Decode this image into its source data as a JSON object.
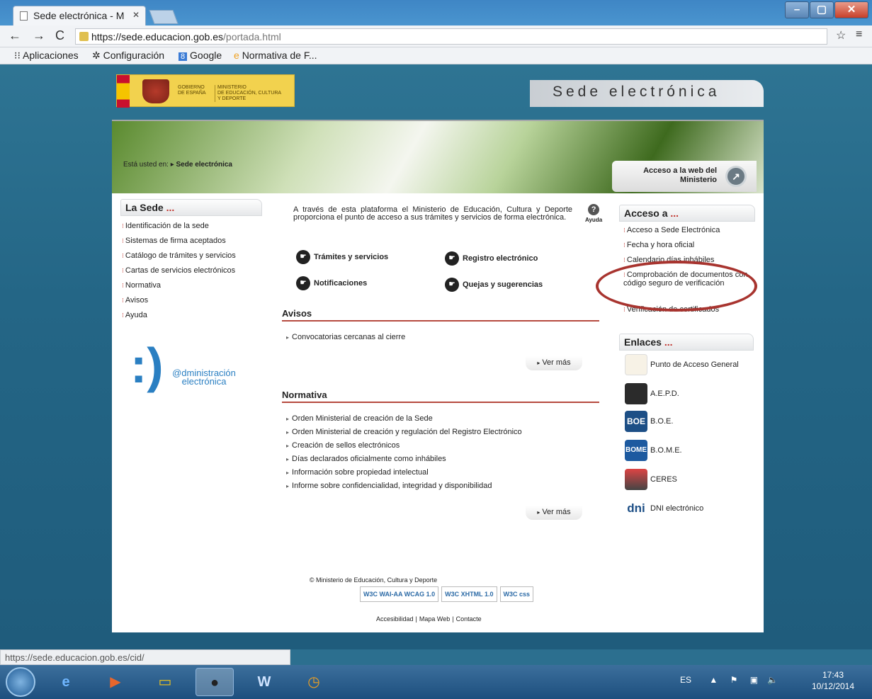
{
  "browser": {
    "tab_title": "Sede electrónica - M",
    "url_host": "https://sede.educacion.gob.es",
    "url_path": "/portada.html",
    "bookmarks": [
      "Aplicaciones",
      "Configuración",
      "Google",
      "Normativa de F..."
    ],
    "status_url": "https://sede.educacion.gob.es/cid/"
  },
  "header": {
    "gov1": "GOBIERNO\nDE ESPAÑA",
    "gov2": "MINISTERIO\nDE EDUCACIÓN, CULTURA\nY DEPORTE",
    "site_title": "Sede electrónica"
  },
  "breadcrumb": {
    "prefix": "Está usted en:",
    "current": "Sede electrónica"
  },
  "access_web": "Acceso a la web del Ministerio",
  "left": {
    "heading": "La Sede",
    "links": [
      "Identificación de la sede",
      "Sistemas de firma aceptados",
      "Catálogo de trámites y servicios",
      "Cartas de servicios electrónicos",
      "Normativa",
      "Avisos",
      "Ayuda"
    ],
    "ae_text": "@dministración electrónica"
  },
  "center": {
    "intro": "A través de esta plataforma el Ministerio de Educación, Cultura y Deporte proporciona el punto de acceso a sus trámites y servicios de forma electrónica.",
    "help": "Ayuda",
    "quick": [
      "Trámites y servicios",
      "Registro electrónico",
      "Notificaciones",
      "Quejas y sugerencias"
    ],
    "avisos_title": "Avisos",
    "avisos": [
      "Convocatorias cercanas al cierre"
    ],
    "normativa_title": "Normativa",
    "normativa": [
      "Orden Ministerial de creación de la Sede",
      "Orden Ministerial de creación y regulación del Registro Electrónico",
      "Creación de sellos electrónicos",
      "Días declarados oficialmente como inhábiles",
      "Información sobre propiedad intelectual",
      "Informe sobre confidencialidad, integridad y disponibilidad"
    ],
    "ver_mas": "Ver más"
  },
  "right": {
    "acceso_title": "Acceso a",
    "acceso": [
      "Acceso a Sede Electrónica",
      "Fecha y hora oficial",
      "Calendario días inhábiles",
      "Comprobación de documentos con código seguro de verificación",
      "Verificación de certificados"
    ],
    "enlaces_title": "Enlaces",
    "enlaces": [
      "Punto de Acceso General",
      "A.E.P.D.",
      "B.O.E.",
      "B.O.M.E.",
      "CERES",
      "DNI electrónico"
    ],
    "enlaces_logos": [
      "",
      "",
      "BOE",
      "BOME",
      "",
      "dni"
    ]
  },
  "footer": {
    "copyright": "© Ministerio de Educación, Cultura y Deporte",
    "badges": [
      "W3C WAI-AA WCAG 1.0",
      "W3C XHTML 1.0",
      "W3C css"
    ],
    "links": [
      "Accesibilidad",
      "Mapa Web",
      "Contacte"
    ]
  },
  "taskbar": {
    "lang": "ES",
    "time": "17:43",
    "date": "10/12/2014"
  },
  "colors": {
    "accent": "#b64a3f",
    "link_blue": "#2a7fc2"
  }
}
